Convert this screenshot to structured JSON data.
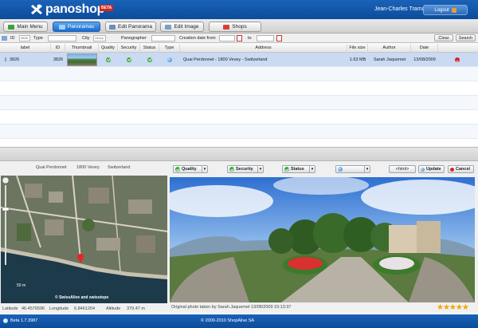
{
  "app": {
    "name": "panoshop",
    "badge": "BETA",
    "user": "Jean-Charles Tramasure",
    "logout_label": "Logout"
  },
  "tabs": [
    {
      "label": "Main Menu",
      "active": false
    },
    {
      "label": "Panoramas",
      "active": true
    },
    {
      "label": "Edit Panorama",
      "active": false
    },
    {
      "label": "Edit Image",
      "active": false
    },
    {
      "label": "Shops",
      "active": false
    }
  ],
  "filters": {
    "id_label": "ID",
    "id_value": "3826",
    "type_label": "Type",
    "city_label": "City",
    "city_value": "Vevey",
    "panographer_label": "Panographer",
    "date_from_label": "Creation date from",
    "date_to_label": "to",
    "clear_label": "Clear",
    "search_label": "Search"
  },
  "grid": {
    "columns": [
      "label",
      "ID",
      "Thumbnail",
      "Quality",
      "Security",
      "Status",
      "Type",
      "Address",
      "File size",
      "Author",
      "Date"
    ],
    "rows": [
      {
        "label": "3826",
        "id": "3826",
        "address": "Quai Perdonnet - 1800 Vevey - Switzerland",
        "file_size": "1.63 MB",
        "author": "Sarah Jaquemet",
        "date": "13/08/2009"
      }
    ]
  },
  "detail": {
    "address_parts": [
      "Quai Perdonnet",
      "1800 Vevey",
      "Switzerland"
    ],
    "map_scale": "50 m",
    "map_copyright": "© SwissAlive and swisstopo",
    "latitude_label": "Latitude",
    "latitude": "46.4576596",
    "longitude_label": "Longitude",
    "longitude": "6.8461204",
    "altitude_label": "Altitude",
    "altitude": "379.47 m",
    "quality_label": "Quality",
    "security_label": "Security",
    "status_label": "Status",
    "html_label": "<html>",
    "update_label": "Update",
    "cancel_label": "Cancel",
    "caption": "Original photo taken by Sarah Jaquemet 13/08/2009 15:13:37",
    "rating": 5
  },
  "footer": {
    "version": "Beta 1.7.3987",
    "copyright": "© 2009-2010 ShopAlive SA"
  },
  "colors": {
    "brand_blue": "#1a62b8",
    "ok_green": "#3caa37",
    "delete_red": "#d32323",
    "star": "#f0a500"
  }
}
